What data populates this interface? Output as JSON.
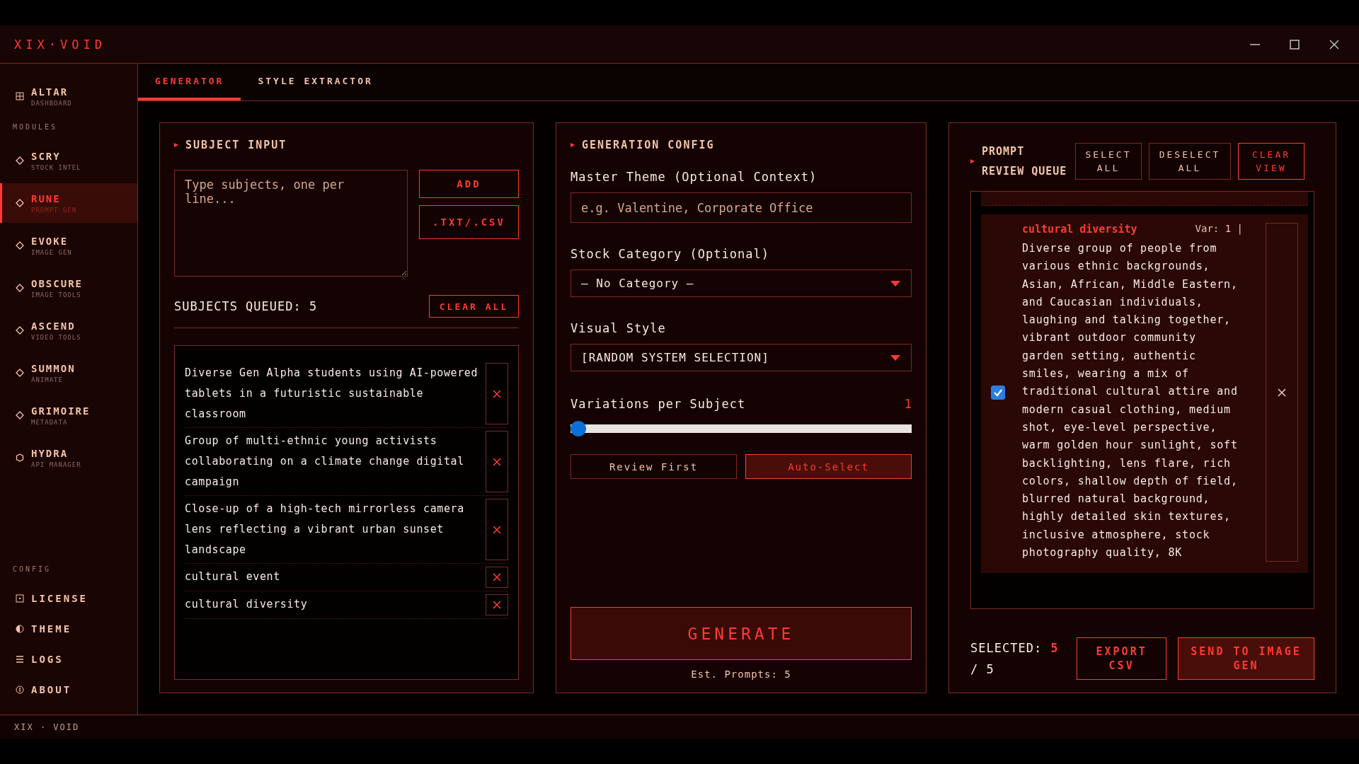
{
  "window": {
    "title": "XIX·VOID"
  },
  "sidebar": {
    "top_item": {
      "label": "ALTAR",
      "sub": "DASHBOARD",
      "selected": false
    },
    "modules_heading": "MODULES",
    "modules": [
      {
        "label": "SCRY",
        "sub": "STOCK INTEL",
        "selected": false
      },
      {
        "label": "RUNE",
        "sub": "PROMPT GEN",
        "selected": true
      },
      {
        "label": "EVOKE",
        "sub": "IMAGE GEN",
        "selected": false
      },
      {
        "label": "OBSCURE",
        "sub": "IMAGE TOOLS",
        "selected": false
      },
      {
        "label": "ASCEND",
        "sub": "VIDEO TOOLS",
        "selected": false
      },
      {
        "label": "SUMMON",
        "sub": "ANIMATE",
        "selected": false
      },
      {
        "label": "GRIMOIRE",
        "sub": "METADATA",
        "selected": false
      },
      {
        "label": "HYDRA",
        "sub": "API MANAGER",
        "selected": false
      }
    ],
    "config_heading": "CONFIG",
    "config": [
      {
        "kind": "license",
        "label": "LICENSE"
      },
      {
        "kind": "theme",
        "label": "THEME"
      },
      {
        "kind": "logs",
        "label": "LOGS"
      },
      {
        "kind": "about",
        "label": "ABOUT"
      }
    ]
  },
  "tabs": [
    {
      "label": "GENERATOR",
      "selected": true
    },
    {
      "label": "STYLE EXTRACTOR",
      "selected": false
    }
  ],
  "subject_input": {
    "title": "SUBJECT INPUT",
    "placeholder": "Type subjects, one per line...",
    "add_button": "ADD",
    "file_button": ".TXT/.CSV",
    "queued": "SUBJECTS QUEUED: 5",
    "clear_button": "CLEAR ALL",
    "subjects": [
      "Diverse Gen Alpha students using AI-powered tablets in a futuristic sustainable classroom",
      "Group of multi-ethnic young activists collaborating on a climate change digital campaign",
      "Close-up of a high-tech mirrorless camera lens reflecting a vibrant urban sunset landscape",
      "cultural event",
      "cultural diversity"
    ]
  },
  "generation_config": {
    "title": "GENERATION CONFIG",
    "theme_label": "Master Theme (Optional Context)",
    "theme_placeholder": "e.g. Valentine, Corporate Office",
    "category_label": "Stock Category (Optional)",
    "category_value": "– No Category –",
    "style_label": "Visual Style",
    "style_value": "[RANDOM SYSTEM SELECTION]",
    "variations_label": "Variations per Subject",
    "variations_value": "1",
    "variations": {
      "level": 0
    },
    "modes": [
      {
        "label": "Review First",
        "selected": false
      },
      {
        "label": "Auto-Select",
        "selected": true
      }
    ],
    "generate_button": "GENERATE",
    "estimate": "Est. Prompts: 5"
  },
  "review_queue": {
    "title": "PROMPT REVIEW QUEUE",
    "buttons": [
      {
        "label": "SELECT ALL",
        "kind": "plain"
      },
      {
        "label": "DESELECT ALL",
        "kind": "plain"
      },
      {
        "label": "CLEAR VIEW",
        "kind": "danger"
      }
    ],
    "cards": [
      {
        "subject": "cultural diversity",
        "variation": "Var: 1 |",
        "checked": true,
        "prompt": "Diverse group of people from various ethnic backgrounds, Asian, African, Middle Eastern, and Caucasian individuals, laughing and talking together, vibrant outdoor community garden setting, authentic smiles, wearing a mix of traditional cultural attire and modern casual clothing, medium shot, eye-level perspective, warm golden hour sunlight, soft backlighting, lens flare, rich colors, shallow depth of field, blurred natural background, highly detailed skin textures, inclusive atmosphere, stock photography quality, 8K"
      }
    ],
    "selected_label": "SELECTED:",
    "selected_count": "5",
    "total": "/ 5",
    "export_button": "EXPORT CSV",
    "send_button": "SEND TO IMAGE GEN"
  },
  "status_bar": {
    "label": "XIX · VOID"
  }
}
